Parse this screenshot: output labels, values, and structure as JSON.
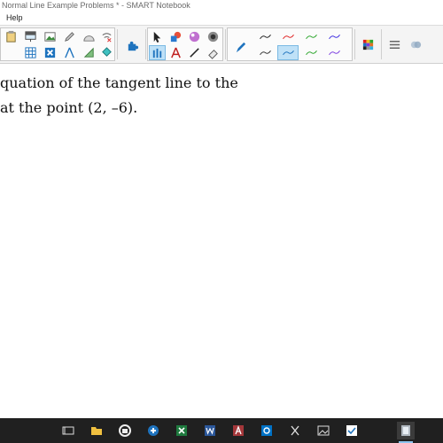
{
  "window": {
    "title": "Normal Line Example Problems * - SMART Notebook"
  },
  "menu": {
    "items": [
      "Help"
    ]
  },
  "toolbar": {
    "accent": "#1e73be",
    "pen_colors": [
      "#000000",
      "#1f1f1f",
      "#e02020",
      "#2aa52a",
      "#3b2ae0",
      "#2aa52a",
      "#7a3be0"
    ]
  },
  "document": {
    "line1": "quation of the tangent line to the",
    "line2": "at the point (2, –6)."
  },
  "taskbar": {
    "apps": [
      "task-view-icon",
      "file-explorer-icon",
      "edge-icon",
      "store-icon",
      "excel-icon",
      "word-icon",
      "access-icon",
      "outlook-icon",
      "snipping-icon",
      "photos-icon",
      "sticky-notes-icon",
      "smart-notebook-icon"
    ]
  }
}
